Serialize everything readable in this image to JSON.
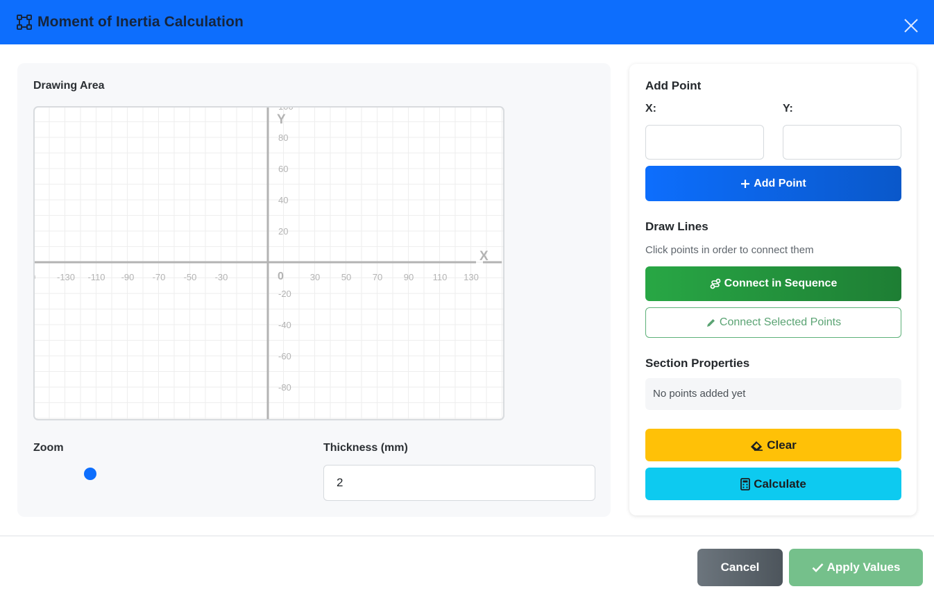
{
  "modal": {
    "title": "Moment of Inertia Calculation",
    "accent_color": "#0d6efd",
    "title_icon": "vector-square-icon",
    "close_icon": "close-icon"
  },
  "drawing": {
    "label": "Drawing Area",
    "x_axis_label": "X",
    "y_axis_label": "Y",
    "x_ticks_neg": [
      "50",
      "-130",
      "-110",
      "-90",
      "-70",
      "-50",
      "-30"
    ],
    "x_ticks_pos": [
      "30",
      "50",
      "70",
      "90",
      "110",
      "130"
    ],
    "y_ticks_pos": [
      "100",
      "80",
      "60",
      "40",
      "20"
    ],
    "y_ticks_neg": [
      "-20",
      "-40",
      "-60",
      "-80"
    ],
    "origin_label": "0",
    "zoom_label": "Zoom",
    "thickness_label": "Thickness (mm)",
    "thickness_value": "2"
  },
  "add_point": {
    "title": "Add Point",
    "x_label": "X:",
    "y_label": "Y:",
    "x_value": "",
    "y_value": "",
    "button_label": "Add Point",
    "button_icon": "plus-icon"
  },
  "draw_lines": {
    "title": "Draw Lines",
    "hint": "Click points in order to connect them",
    "sequence_label": "Connect in Sequence",
    "sequence_icon": "route-icon",
    "selected_label": "Connect Selected Points",
    "selected_icon": "pencil-icon"
  },
  "section_properties": {
    "title": "Section Properties",
    "empty_text": "No points added yet"
  },
  "actions": {
    "clear_label": "Clear",
    "clear_icon": "eraser-icon",
    "calculate_label": "Calculate",
    "calculate_icon": "calculator-icon"
  },
  "footer": {
    "cancel_label": "Cancel",
    "apply_label": "Apply Values",
    "apply_icon": "check-icon"
  }
}
